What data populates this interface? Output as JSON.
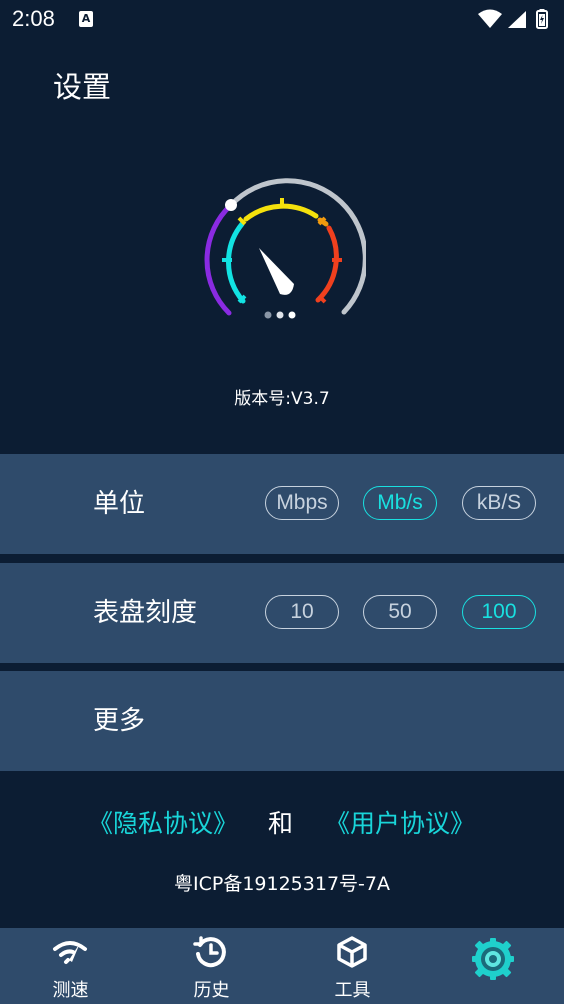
{
  "status_bar": {
    "time": "2:08",
    "notification_icon": "A",
    "icons": [
      "wifi-icon",
      "signal-icon",
      "battery-icon"
    ]
  },
  "page": {
    "title": "设置",
    "logo_icon": "speedometer-gauge-icon",
    "version": "版本号:V3.7"
  },
  "settings": {
    "unit": {
      "label": "单位",
      "options": [
        "Mbps",
        "Mb/s",
        "kB/S"
      ],
      "selected": "Mb/s"
    },
    "dial_scale": {
      "label": "表盘刻度",
      "options": [
        "10",
        "50",
        "100"
      ],
      "selected": "100"
    },
    "more": {
      "label": "更多"
    }
  },
  "agreements": {
    "privacy": "《隐私协议》",
    "and": "和",
    "user": "《用户协议》"
  },
  "icp": "粤ICP备19125317号-7A",
  "bottom_nav": {
    "items": [
      {
        "label": "测速",
        "icon": "speed-test-icon"
      },
      {
        "label": "历史",
        "icon": "history-icon"
      },
      {
        "label": "工具",
        "icon": "tools-box-icon"
      },
      {
        "label": "",
        "icon": "settings-gear-icon",
        "active": true
      }
    ]
  },
  "colors": {
    "background": "#0c1d33",
    "panel": "#2f4b6b",
    "accent": "#19e0e0",
    "pill_inactive": "#c7d2de"
  }
}
